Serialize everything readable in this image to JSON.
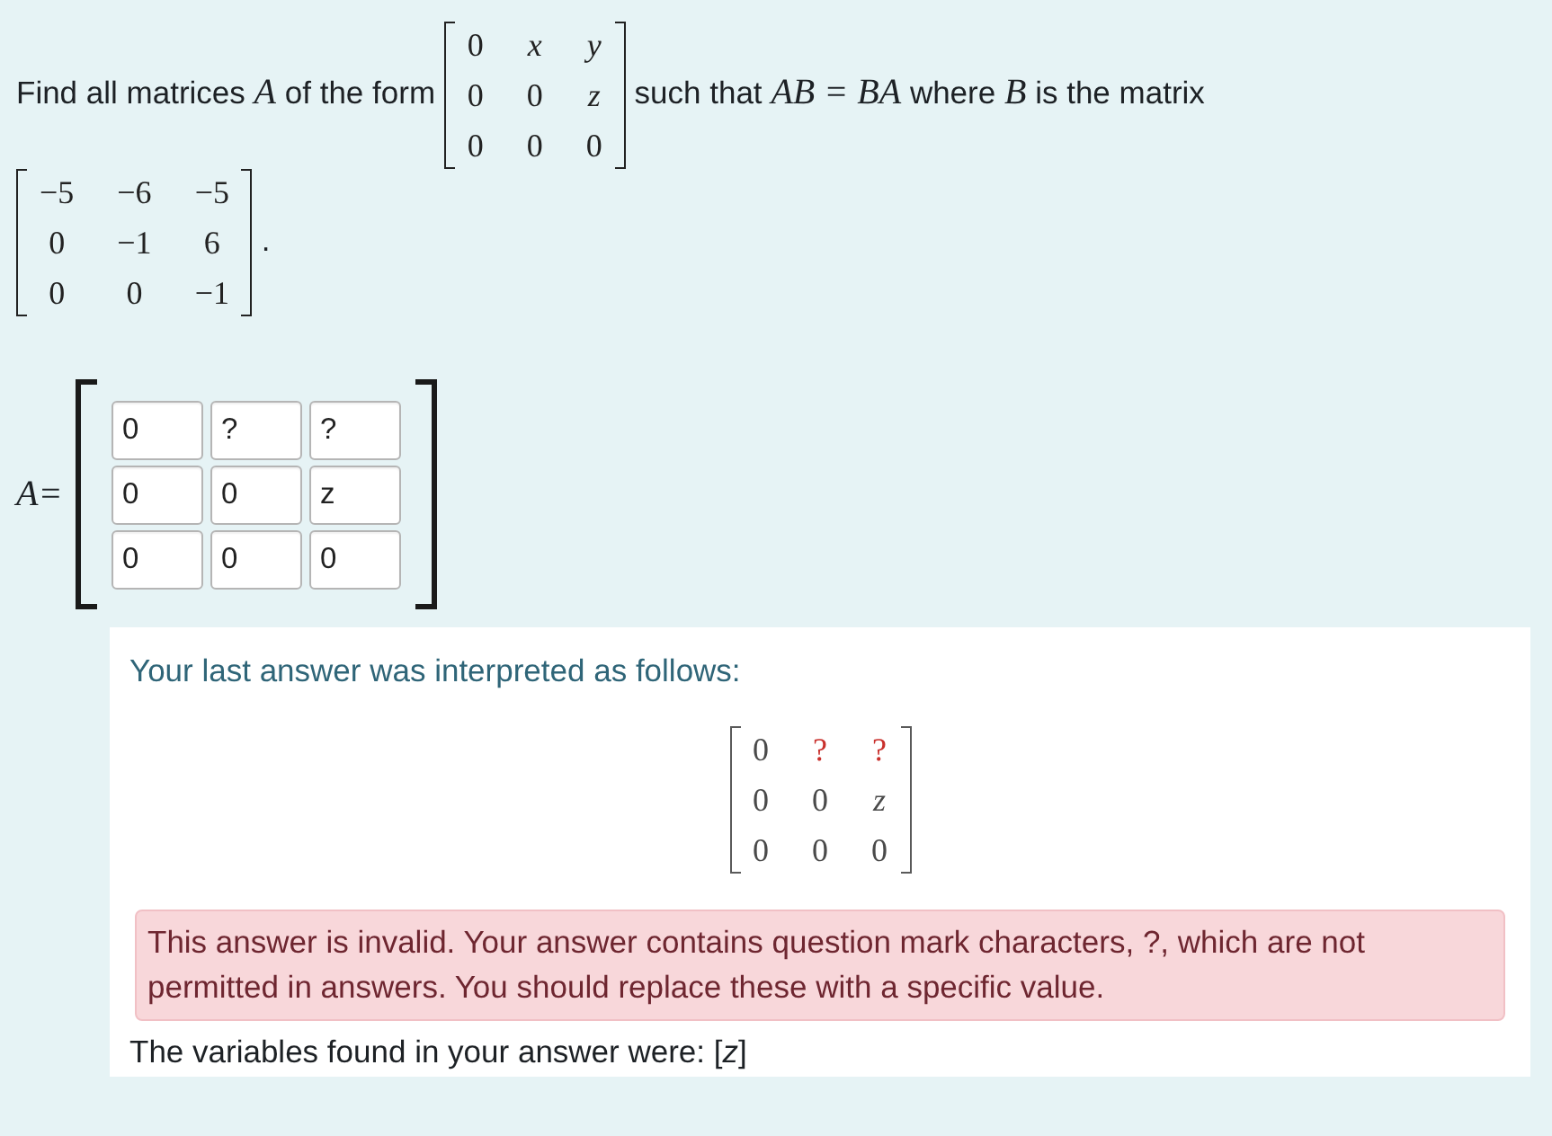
{
  "question": {
    "segments": [
      {
        "kind": "text",
        "text": "Find all matrices"
      },
      {
        "kind": "math",
        "text": "A"
      },
      {
        "kind": "text",
        "text": "of the form"
      },
      {
        "kind": "matrix",
        "rows": [
          [
            {
              "text": "0",
              "kind": "number"
            },
            {
              "text": "x",
              "kind": "variable"
            },
            {
              "text": "y",
              "kind": "variable"
            }
          ],
          [
            {
              "text": "0",
              "kind": "number"
            },
            {
              "text": "0",
              "kind": "number"
            },
            {
              "text": "z",
              "kind": "variable"
            }
          ],
          [
            {
              "text": "0",
              "kind": "number"
            },
            {
              "text": "0",
              "kind": "number"
            },
            {
              "text": "0",
              "kind": "number"
            }
          ]
        ]
      },
      {
        "kind": "text",
        "text": "such that"
      },
      {
        "kind": "math",
        "text": "AB = BA"
      },
      {
        "kind": "text",
        "text": "where"
      },
      {
        "kind": "math",
        "text": "B"
      },
      {
        "kind": "text",
        "text": "is the matrix"
      },
      {
        "kind": "matrix",
        "rows": [
          [
            {
              "text": "−5",
              "kind": "number"
            },
            {
              "text": "−6",
              "kind": "number"
            },
            {
              "text": "−5",
              "kind": "number"
            }
          ],
          [
            {
              "text": "0",
              "kind": "number"
            },
            {
              "text": "−1",
              "kind": "number"
            },
            {
              "text": "6",
              "kind": "number"
            }
          ],
          [
            {
              "text": "0",
              "kind": "number"
            },
            {
              "text": "0",
              "kind": "number"
            },
            {
              "text": "−1",
              "kind": "number"
            }
          ]
        ]
      },
      {
        "kind": "text",
        "text": "."
      }
    ]
  },
  "answer": {
    "label": "A=",
    "inputs": [
      [
        "0",
        "?",
        "?"
      ],
      [
        "0",
        "0",
        "z"
      ],
      [
        "0",
        "0",
        "0"
      ]
    ]
  },
  "feedback": {
    "heading": "Your last answer was interpreted as follows:",
    "matrix": {
      "rows": [
        [
          {
            "text": "0",
            "kind": "number",
            "invalid": false
          },
          {
            "text": "?",
            "kind": "symbol",
            "invalid": true
          },
          {
            "text": "?",
            "kind": "symbol",
            "invalid": true
          }
        ],
        [
          {
            "text": "0",
            "kind": "number",
            "invalid": false
          },
          {
            "text": "0",
            "kind": "number",
            "invalid": false
          },
          {
            "text": "z",
            "kind": "variable",
            "invalid": false
          }
        ],
        [
          {
            "text": "0",
            "kind": "number",
            "invalid": false
          },
          {
            "text": "0",
            "kind": "number",
            "invalid": false
          },
          {
            "text": "0",
            "kind": "number",
            "invalid": false
          }
        ]
      ]
    },
    "error": "This answer is invalid. Your answer contains question mark characters, ?, which are not permitted in answers. You should replace these with a specific value.",
    "variables_text": "The variables found in your answer were: [*z*]"
  }
}
